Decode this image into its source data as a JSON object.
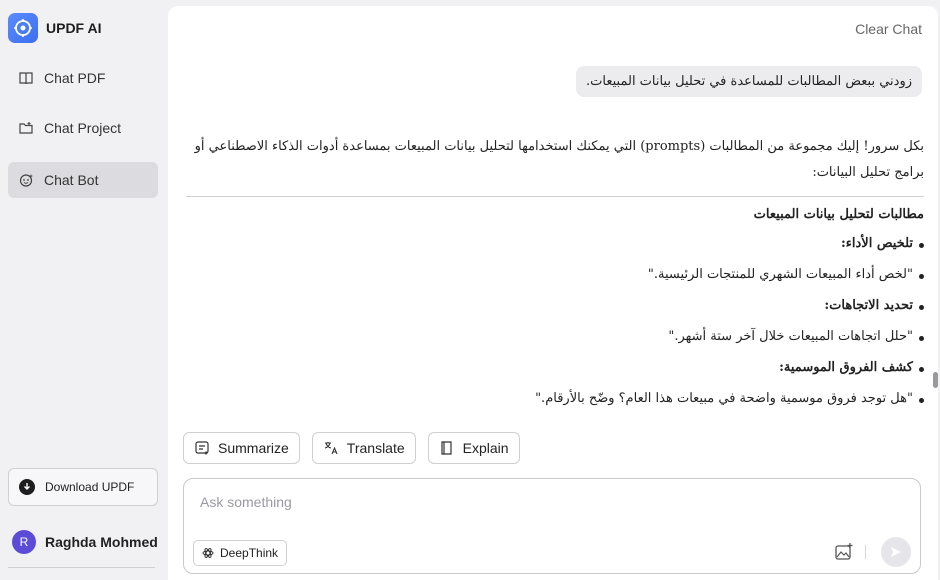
{
  "brand": {
    "name": "UPDF AI",
    "accent": "#3c6df0"
  },
  "sidebar": {
    "items": [
      {
        "label": "Chat PDF",
        "icon": "book-icon"
      },
      {
        "label": "Chat Project",
        "icon": "folder-icon"
      },
      {
        "label": "Chat Bot",
        "icon": "bot-icon",
        "active": true
      }
    ],
    "download_label": "Download UPDF",
    "user": {
      "initial": "R",
      "name": "Raghda Mohmed"
    }
  },
  "header": {
    "clear_label": "Clear Chat"
  },
  "chat": {
    "user_message": "زودني ببعض المطالبات للمساعدة في تحليل بيانات المبيعات.",
    "answer": {
      "intro": "بكل سرور! إليك مجموعة من المطالبات (prompts) التي يمكنك استخدامها لتحليل بيانات المبيعات بمساعدة أدوات الذكاء الاصطناعي أو برامج تحليل البيانات:",
      "heading": "مطالبات لتحليل بيانات المبيعات",
      "bullets": [
        {
          "text": "تلخيص الأداء:",
          "bold": true
        },
        {
          "text": "\"لخص أداء المبيعات الشهري للمنتجات الرئيسية.\"",
          "bold": false
        },
        {
          "text": "تحديد الاتجاهات:",
          "bold": true
        },
        {
          "text": "\"حلل اتجاهات المبيعات خلال آخر ستة أشهر.\"",
          "bold": false
        },
        {
          "text": "كشف الفروق الموسمية:",
          "bold": true
        },
        {
          "text": "\"هل توجد فروق موسمية واضحة في مبيعات هذا العام؟ وضّح بالأرقام.\"",
          "bold": false
        }
      ]
    }
  },
  "actions": {
    "summarize": "Summarize",
    "translate": "Translate",
    "explain": "Explain"
  },
  "input": {
    "placeholder": "Ask something",
    "value": "",
    "deepthink_label": "DeepThink"
  }
}
